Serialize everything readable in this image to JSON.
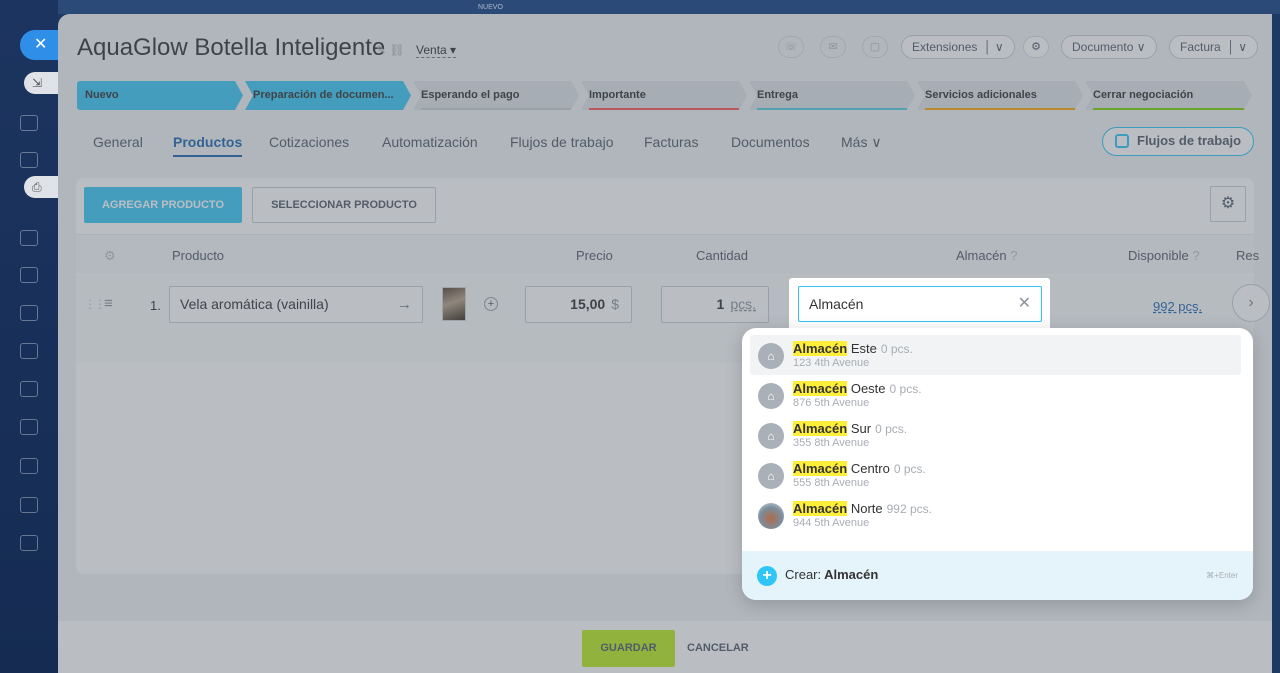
{
  "top_strip": {
    "label": "NUEVO"
  },
  "header": {
    "title": "AquaGlow Botella Inteligente",
    "category": "Venta",
    "extensions_label": "Extensiones",
    "document_label": "Documento",
    "invoice_label": "Factura"
  },
  "stages": [
    {
      "label": "Nuevo",
      "color": "#3bc8f5"
    },
    {
      "label": "Preparación de documen...",
      "color": "#3bc8f5"
    },
    {
      "label": "Esperando el pago",
      "color": "#c6cdd3"
    },
    {
      "label": "Importante",
      "color": "#ff5752"
    },
    {
      "label": "Entrega",
      "color": "#55d0e0"
    },
    {
      "label": "Servicios adicionales",
      "color": "#ffa900"
    },
    {
      "label": "Cerrar negociación",
      "color": "#7bd500"
    }
  ],
  "tabs": [
    {
      "label": "General"
    },
    {
      "label": "Productos"
    },
    {
      "label": "Cotizaciones"
    },
    {
      "label": "Automatización"
    },
    {
      "label": "Flujos de trabajo"
    },
    {
      "label": "Facturas"
    },
    {
      "label": "Documentos"
    },
    {
      "label": "Más"
    }
  ],
  "workflow_button": "Flujos de trabajo",
  "products": {
    "add_label": "AGREGAR PRODUCTO",
    "select_label": "SELECCIONAR PRODUCTO",
    "columns": {
      "product": "Producto",
      "price": "Precio",
      "quantity": "Cantidad",
      "warehouse": "Almacén",
      "available": "Disponible",
      "reserved": "Res"
    },
    "row": {
      "number": "1.",
      "name": "Vela aromática (vainilla)",
      "price": "15,00",
      "currency": "$",
      "quantity": "1",
      "unit": "pcs.",
      "available": "992 pcs."
    }
  },
  "warehouse_search": {
    "value": "Almacén",
    "items": [
      {
        "highlight": "Almacén",
        "name": "Este",
        "count": "0 pcs.",
        "address": "123 4th Avenue"
      },
      {
        "highlight": "Almacén",
        "name": "Oeste",
        "count": "0 pcs.",
        "address": "876 5th Avenue"
      },
      {
        "highlight": "Almacén",
        "name": "Sur",
        "count": "0 pcs.",
        "address": "355 8th Avenue"
      },
      {
        "highlight": "Almacén",
        "name": "Centro",
        "count": "0 pcs.",
        "address": "555 8th Avenue"
      },
      {
        "highlight": "Almacén",
        "name": "Norte",
        "count": "992 pcs.",
        "address": "944 5th Avenue"
      }
    ],
    "create_prefix": "Crear:",
    "create_value": "Almacén",
    "create_hint": "⌘+Enter"
  },
  "footer": {
    "save_label": "GUARDAR",
    "cancel_label": "CANCELAR"
  }
}
